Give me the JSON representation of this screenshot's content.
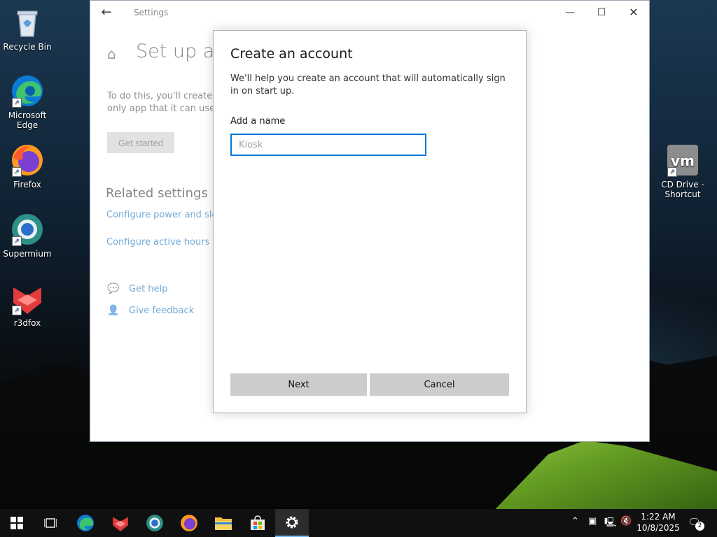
{
  "desktop": {
    "icons": [
      {
        "label": "Recycle Bin"
      },
      {
        "label": "Microsoft Edge"
      },
      {
        "label": "Firefox"
      },
      {
        "label": "Supermium"
      },
      {
        "label": "r3dfox"
      },
      {
        "label": "CD Drive - Shortcut"
      }
    ]
  },
  "window": {
    "title": "Settings",
    "heading": "Set up a k",
    "description_line1": "To do this, you'll create o",
    "description_line2": "only app that it can use (",
    "get_started": "Get started",
    "related_heading": "Related settings",
    "links": {
      "power": "Configure power and sle",
      "active_hours": "Configure active hours",
      "get_help": "Get help",
      "give_feedback": "Give feedback"
    }
  },
  "dialog": {
    "title": "Create an account",
    "description": "We'll help you create an account that will automatically sign in on start up.",
    "name_label": "Add a name",
    "name_placeholder": "Kiosk",
    "name_value": "",
    "next_label": "Next",
    "cancel_label": "Cancel"
  },
  "taskbar": {
    "time": "1:22 AM",
    "date": "10/8/2025",
    "notification_count": "2"
  },
  "colors": {
    "accent": "#0078d7",
    "link": "#0063b1"
  }
}
